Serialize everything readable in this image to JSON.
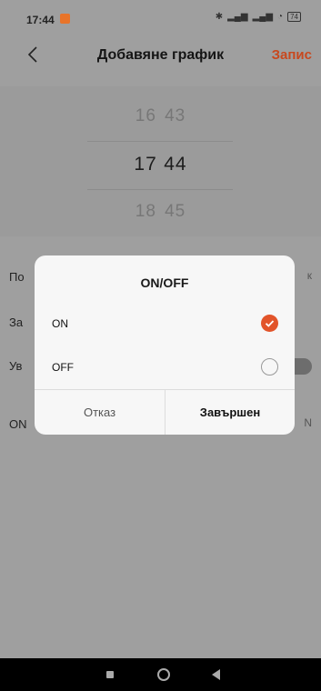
{
  "status_bar": {
    "time": "17:44",
    "battery": "74"
  },
  "app_bar": {
    "title": "Добавяне график",
    "save_label": "Запис"
  },
  "time_picker": {
    "prev": {
      "hour": "16",
      "minute": "43"
    },
    "current": {
      "hour": "17",
      "minute": "44"
    },
    "next": {
      "hour": "18",
      "minute": "45"
    }
  },
  "settings_partial": {
    "row1_label": "По",
    "row1_value": "к",
    "row2_label": "За",
    "row3_label": "Ув",
    "row4_label": "ON",
    "row4_value": "N"
  },
  "dialog": {
    "title": "ON/OFF",
    "options": [
      {
        "label": "ON",
        "selected": true
      },
      {
        "label": "OFF",
        "selected": false
      }
    ],
    "cancel_label": "Отказ",
    "done_label": "Завършен"
  },
  "colors": {
    "accent": "#e2542a",
    "save_text": "#c8481e"
  }
}
